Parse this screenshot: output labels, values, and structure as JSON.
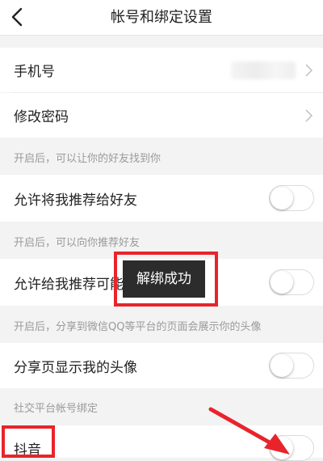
{
  "nav": {
    "title": "帐号和绑定设置",
    "back_icon": "chevron-left-icon"
  },
  "account": {
    "phone_label": "手机号",
    "password_label": "修改密码"
  },
  "sections": {
    "find_me": "开启后，可以让你的好友找到你",
    "recommend": "开启后，可以向你推荐好友",
    "share": "开启后，分享到微信QQ等平台的页面会展示你的头像",
    "social": "社交平台帐号绑定"
  },
  "settings": {
    "recommend_me": {
      "label": "允许将我推荐给好友",
      "on": false
    },
    "recommend_to_me": {
      "label": "允许给我推荐可能认识的人",
      "on": false
    },
    "share_avatar": {
      "label": "分享页显示我的头像",
      "on": false
    },
    "douyin": {
      "label": "抖音",
      "on": false
    }
  },
  "toast": {
    "text": "解绑成功"
  },
  "colors": {
    "highlight": "#e8242b",
    "toast_bg": "#2c2c2c",
    "section_bg": "#f3f3f3",
    "section_text": "#9a9a9a"
  }
}
